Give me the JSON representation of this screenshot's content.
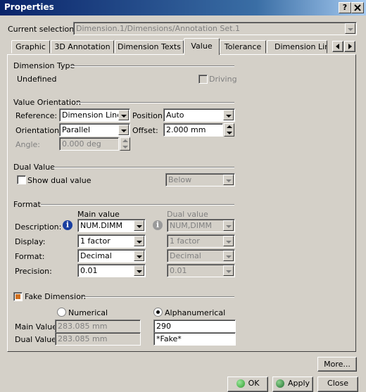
{
  "window": {
    "title": "Properties",
    "help": "?",
    "close": "X"
  },
  "selection": {
    "label": "Current selection :",
    "value": "Dimension.1/Dimensions/Annotation Set.1"
  },
  "tabs": [
    "Graphic",
    "3D Annotation",
    "Dimension Texts",
    "Value",
    "Tolerance",
    "Dimension Line"
  ],
  "dimension_type": {
    "heading": "Dimension Type",
    "value": "Undefined",
    "driving_label": "Driving",
    "driving_checked": false
  },
  "value_orientation": {
    "heading": "Value Orientation",
    "reference_label": "Reference:",
    "reference_value": "Dimension Line",
    "position_label": "Position:",
    "position_value": "Auto",
    "orientation_label": "Orientation:",
    "orientation_value": "Parallel",
    "offset_label": "Offset:",
    "offset_value": "2.000 mm",
    "angle_label": "Angle:",
    "angle_value": "0.000 deg"
  },
  "dual_value": {
    "heading": "Dual Value",
    "show_label": "Show dual value",
    "show_checked": false,
    "position_value": "Below"
  },
  "format": {
    "heading": "Format",
    "main_header": "Main value",
    "dual_header": "Dual value",
    "description_label": "Description:",
    "description_main": "NUM.DIMM",
    "description_dual": "NUM,DIMM",
    "display_label": "Display:",
    "display_main": "1 factor",
    "display_dual": "1 factor",
    "format_label": "Format:",
    "format_main": "Decimal",
    "format_dual": "Decimal",
    "precision_label": "Precision:",
    "precision_main": "0.01",
    "precision_dual": "0.01"
  },
  "fake_dimension": {
    "heading": "Fake Dimension",
    "checked": true,
    "numerical_label": "Numerical",
    "alphanumerical_label": "Alphanumerical",
    "selected": "Alphanumerical",
    "main_label": "Main Value:",
    "main_numerical": "283.085 mm",
    "main_alpha": "290",
    "dual_label": "Dual Value:",
    "dual_numerical": "283.085 mm",
    "dual_alpha": "*Fake*"
  },
  "buttons": {
    "more": "More...",
    "ok": "OK",
    "apply": "Apply",
    "close": "Close"
  },
  "colors": {
    "accent": "#0a246a",
    "ok_icon": "#2e9b2e",
    "apply_icon": "#1f6f2f",
    "info_icon": "#1a3fa0"
  }
}
